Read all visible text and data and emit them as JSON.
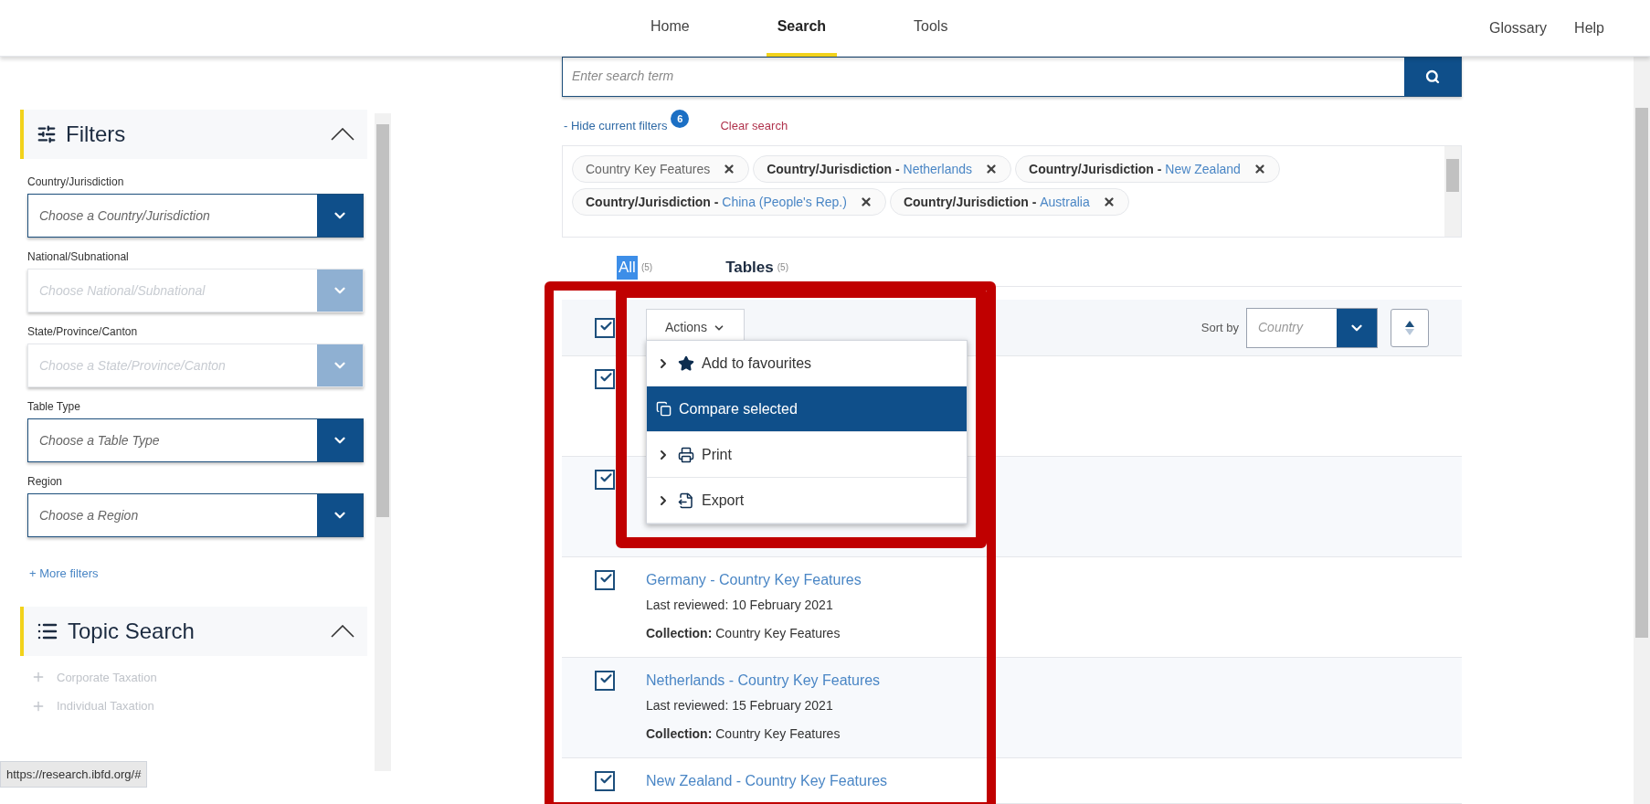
{
  "nav": {
    "items": [
      {
        "label": "Home",
        "selected": false
      },
      {
        "label": "Search",
        "selected": true
      },
      {
        "label": "Tools",
        "selected": false
      }
    ],
    "links": [
      "Glossary",
      "Help"
    ]
  },
  "sidebar": {
    "filters_title": "Filters",
    "fields": [
      {
        "label": "Country/Jurisdiction",
        "placeholder": "Choose a Country/Jurisdiction",
        "disabled": false
      },
      {
        "label": "National/Subnational",
        "placeholder": "Choose National/Subnational",
        "disabled": true
      },
      {
        "label": "State/Province/Canton",
        "placeholder": "Choose a State/Province/Canton",
        "disabled": true
      },
      {
        "label": "Table Type",
        "placeholder": "Choose a Table Type",
        "disabled": false
      },
      {
        "label": "Region",
        "placeholder": "Choose a Region",
        "disabled": false
      }
    ],
    "more_filters": "+ More filters",
    "topic_title": "Topic Search",
    "topics": [
      "Corporate Taxation",
      "Individual Taxation"
    ]
  },
  "search": {
    "placeholder": "Enter search term"
  },
  "filter_bar": {
    "toggle": "- Hide current filters",
    "count": "6",
    "clear": "Clear search"
  },
  "chips": [
    {
      "label": "Country Key Features"
    },
    {
      "label": "Country/Jurisdiction - ",
      "value": "Netherlands"
    },
    {
      "label": "Country/Jurisdiction - ",
      "value": "New Zealand"
    },
    {
      "label": "Country/Jurisdiction - ",
      "value": "China (People's Rep.)"
    },
    {
      "label": "Country/Jurisdiction - ",
      "value": "Australia"
    }
  ],
  "tabs": [
    {
      "label": "All",
      "count": "(5)",
      "selected": false
    },
    {
      "label": "Tables",
      "count": "(5)",
      "selected": true
    }
  ],
  "list_header": {
    "select_all": true,
    "actions": "Actions",
    "sort_label": "Sort by",
    "sort_value": "Country"
  },
  "menu": [
    {
      "kind": "submenu",
      "label": "Add to favourites",
      "selected": false
    },
    {
      "kind": "action",
      "label": "Compare selected",
      "selected": true
    },
    {
      "kind": "submenu",
      "label": "Print",
      "selected": false
    },
    {
      "kind": "submenu",
      "label": "Export",
      "selected": false
    }
  ],
  "results": [
    {
      "checked": true
    },
    {
      "checked": true
    },
    {
      "checked": true,
      "title": "Germany - Country Key Features",
      "reviewed": "Last reviewed: 10 February 2021",
      "collection_label": "Collection:",
      "collection": "Country Key Features"
    },
    {
      "checked": true,
      "title": "Netherlands - Country Key Features",
      "reviewed": "Last reviewed: 15 February 2021",
      "collection_label": "Collection:",
      "collection": "Country Key Features"
    },
    {
      "checked": true,
      "title": "New Zealand - Country Key Features"
    }
  ],
  "status_url": "https://research.ibfd.org/#"
}
